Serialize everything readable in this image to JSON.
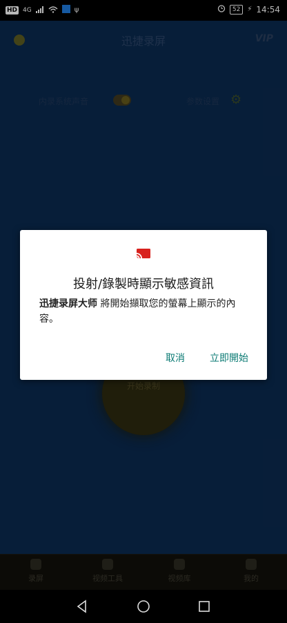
{
  "status_bar": {
    "hd": "HD",
    "signal": "4G",
    "battery": "52",
    "time": "14:54"
  },
  "app": {
    "title": "迅捷录屏",
    "vip": "VIP",
    "audio_label": "内录系统声音",
    "params_label": "参数设置",
    "record_label": "开始录制",
    "nav": [
      {
        "label": "录屏"
      },
      {
        "label": "视频工具"
      },
      {
        "label": "视频库"
      },
      {
        "label": "我的"
      }
    ]
  },
  "dialog": {
    "title": "投射/錄製時顯示敏感資訊",
    "app_name": "迅捷录屏大师",
    "message": " 將開始擷取您的螢幕上顯示的內容。",
    "cancel": "取消",
    "start": "立即開始",
    "icon": "cast-icon",
    "accent": "#0a7a73"
  }
}
